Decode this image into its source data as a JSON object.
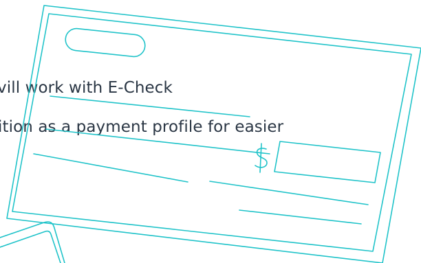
{
  "text": {
    "line1": "vill work with E-Check",
    "line2": "ition as a payment profile for easier"
  },
  "colors": {
    "text": "#2a3644",
    "accent": "#1fc3c9",
    "background": "#ffffff"
  },
  "illustration": {
    "check_symbol": "$",
    "icon_names": [
      "check-illustration",
      "card-illustration"
    ]
  }
}
